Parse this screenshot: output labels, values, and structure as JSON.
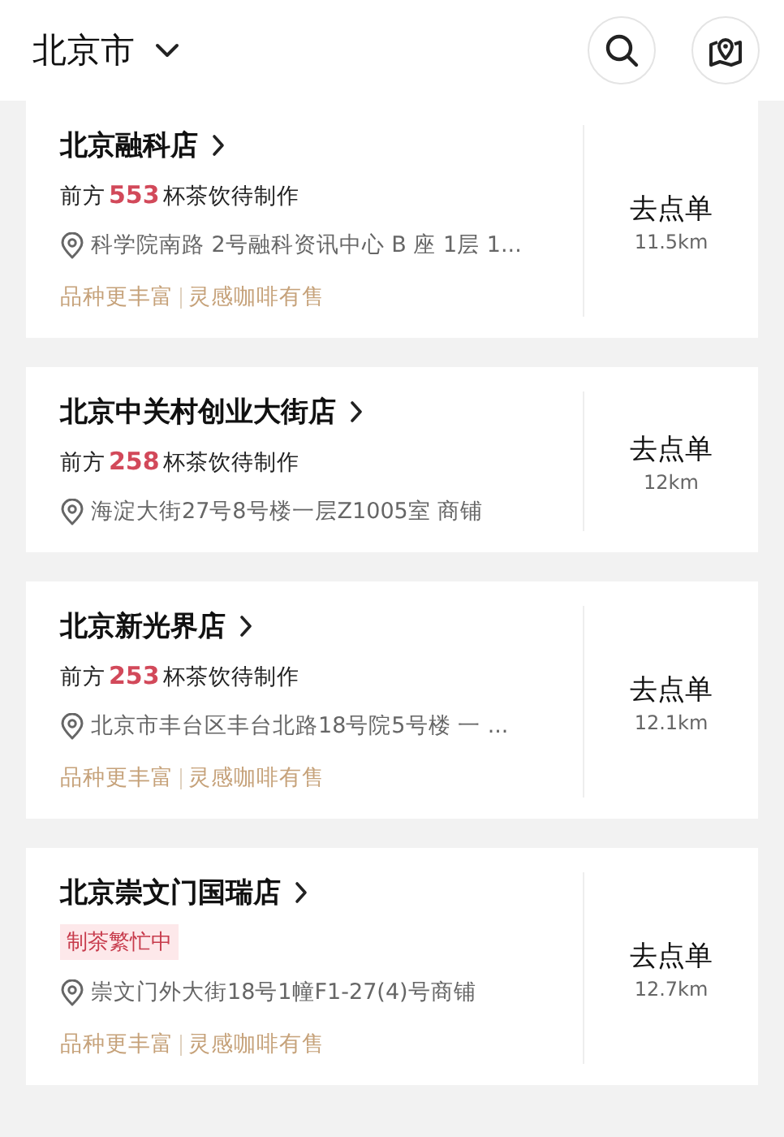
{
  "header": {
    "city": "北京市"
  },
  "stores": [
    {
      "name": "北京融科店",
      "status": {
        "kind": "queue",
        "prefix": "前方",
        "count": "553",
        "suffix": "杯茶饮待制作"
      },
      "address": "科学院南路 2号融科资讯中心 B 座 1层 1...",
      "tags": [
        "品种更丰富",
        "灵感咖啡有售"
      ],
      "action": "去点单",
      "distance": "11.5km"
    },
    {
      "name": "北京中关村创业大街店",
      "status": {
        "kind": "queue",
        "prefix": "前方",
        "count": "258",
        "suffix": "杯茶饮待制作"
      },
      "address": "海淀大街27号8号楼一层Z1005室 商铺",
      "action": "去点单",
      "distance": "12km"
    },
    {
      "name": "北京新光界店",
      "status": {
        "kind": "queue",
        "prefix": "前方",
        "count": "253",
        "suffix": "杯茶饮待制作"
      },
      "address": "北京市丰台区丰台北路18号院5号楼 一 ...",
      "tags": [
        "品种更丰富",
        "灵感咖啡有售"
      ],
      "action": "去点单",
      "distance": "12.1km"
    },
    {
      "name": "北京崇文门国瑞店",
      "status": {
        "kind": "busy",
        "label": "制茶繁忙中"
      },
      "address": "崇文门外大街18号1幢F1-27(4)号商铺",
      "tags": [
        "品种更丰富",
        "灵感咖啡有售"
      ],
      "action": "去点单",
      "distance": "12.7km"
    }
  ]
}
